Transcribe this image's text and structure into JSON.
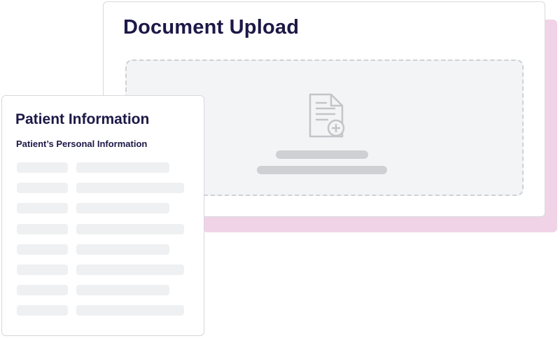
{
  "document_upload": {
    "title": "Document Upload",
    "drop_zone_icon": "document-add-icon"
  },
  "patient_info": {
    "title": "Patient Information",
    "subtitle": "Patient’s Personal Information",
    "rows": 8
  },
  "colors": {
    "heading": "#1c1847",
    "accent_shadow": "#f1d3e7",
    "drop_zone_bg": "#f3f4f6",
    "placeholder": "#cfd0d4",
    "field_placeholder": "#eff0f2"
  }
}
